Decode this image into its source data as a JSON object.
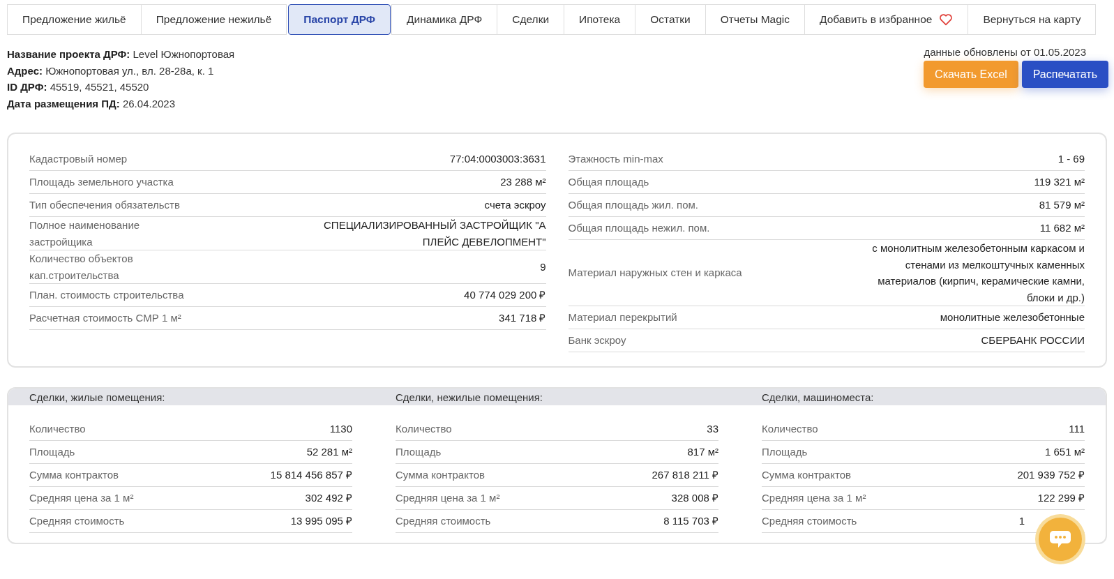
{
  "tabs": [
    {
      "label": "Предложение жильё",
      "selected": false
    },
    {
      "label": "Предложение нежильё",
      "selected": false
    },
    {
      "label": "Паспорт ДРФ",
      "selected": true
    },
    {
      "label": "Динамика ДРФ",
      "selected": false
    },
    {
      "label": "Сделки",
      "selected": false
    },
    {
      "label": "Ипотека",
      "selected": false
    },
    {
      "label": "Остатки",
      "selected": false
    },
    {
      "label": "Отчеты Magic",
      "selected": false
    },
    {
      "label": "Добавить в избранное",
      "selected": false,
      "kind": "favorite"
    },
    {
      "label": "Вернуться на карту",
      "selected": false
    }
  ],
  "project_info": [
    {
      "label": "Название проекта ДРФ:",
      "value": "Level Южнопортовая"
    },
    {
      "label": "Адрес:",
      "value": "Южнопортовая ул., вл. 28-28а, к. 1"
    },
    {
      "label": "ID ДРФ:",
      "value": "45519, 45521, 45520"
    },
    {
      "label": "Дата размещения ПД:",
      "value": "26.04.2023"
    }
  ],
  "updated_note": "данные обновлены от 01.05.2023",
  "buttons": [
    {
      "label": "Скачать Excel",
      "kind": "excel"
    },
    {
      "label": "Распечатать",
      "kind": "print"
    }
  ],
  "passport": {
    "left": [
      {
        "label": "Кадастровый номер",
        "value": "77:04:0003003:3631"
      },
      {
        "label": "Площадь земельного участка",
        "value": "23 288 м²"
      },
      {
        "label": "Тип обеспечения обязательств",
        "value": "счета эскроу"
      },
      {
        "label": "Полное наименование застройщика",
        "value": "СПЕЦИАЛИЗИРОВАННЫЙ ЗАСТРОЙЩИК \"А ПЛЕЙС ДЕВЕЛОПМЕНТ\""
      },
      {
        "label": "Количество объектов кап.строительства",
        "value": "9"
      },
      {
        "label": "План. стоимость строительства",
        "value": "40 774 029 200 ₽"
      },
      {
        "label": "Расчетная стоимость СМР 1 м²",
        "value": "341 718 ₽"
      }
    ],
    "right": [
      {
        "label": "Этажность min-max",
        "value": "1 - 69"
      },
      {
        "label": "Общая площадь",
        "value": "119 321 м²"
      },
      {
        "label": "Общая площадь жил. пом.",
        "value": "81 579 м²"
      },
      {
        "label": "Общая площадь нежил. пом.",
        "value": "11 682 м²"
      },
      {
        "label": "Материал наружных стен и каркаса",
        "value": "с монолитным железобетонным каркасом и стенами из мелкоштучных каменных материалов (кирпич, керамические камни, блоки и др.)"
      },
      {
        "label": "Материал перекрытий",
        "value": "монолитные железобетонные"
      },
      {
        "label": "Банк эскроу",
        "value": "СБЕРБАНК РОССИИ"
      }
    ]
  },
  "deals": [
    {
      "title": "Сделки, жилые помещения:",
      "rows": [
        {
          "label": "Количество",
          "value": "1130"
        },
        {
          "label": "Площадь",
          "value": "52 281 м²"
        },
        {
          "label": "Сумма контрактов",
          "value": "15 814 456 857 ₽"
        },
        {
          "label": "Средняя цена за 1 м²",
          "value": "302 492 ₽"
        },
        {
          "label": "Средняя стоимость",
          "value": "13 995 095 ₽"
        }
      ]
    },
    {
      "title": "Сделки, нежилые помещения:",
      "rows": [
        {
          "label": "Количество",
          "value": "33"
        },
        {
          "label": "Площадь",
          "value": "817 м²"
        },
        {
          "label": "Сумма контрактов",
          "value": "267 818 211 ₽"
        },
        {
          "label": "Средняя цена за 1 м²",
          "value": "328 008 ₽"
        },
        {
          "label": "Средняя стоимость",
          "value": "8 115 703 ₽"
        }
      ]
    },
    {
      "title": "Сделки, машиноместа:",
      "rows": [
        {
          "label": "Количество",
          "value": "111"
        },
        {
          "label": "Площадь",
          "value": "1 651 м²"
        },
        {
          "label": "Сумма контрактов",
          "value": "201 939 752 ₽"
        },
        {
          "label": "Средняя цена за 1 м²",
          "value": "122 299 ₽"
        },
        {
          "label": "Средняя стоимость",
          "value_parts": [
            "1"
          ]
        }
      ]
    }
  ]
}
